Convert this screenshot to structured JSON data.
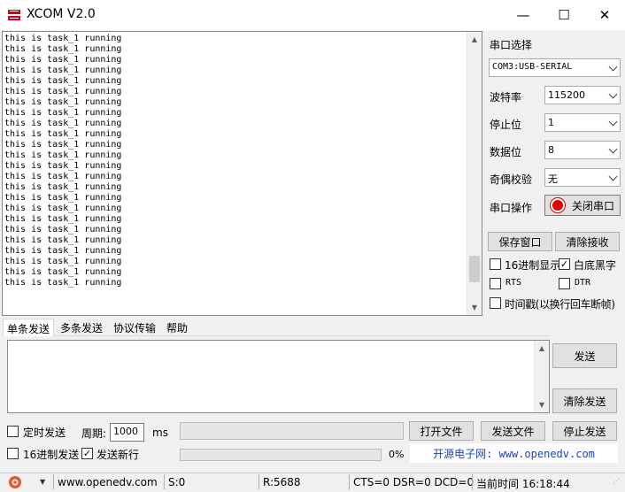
{
  "window": {
    "title": "XCOM V2.0",
    "minimize": "—",
    "maximize": "☐",
    "close": "✕"
  },
  "receive": {
    "lines": [
      "this is task_1 running",
      "this is task_1 running",
      "this is task_1 running",
      "this is task_1 running",
      "this is task_1 running",
      "this is task_1 running",
      "this is task_1 running",
      "this is task_1 running",
      "this is task_1 running",
      "this is task_1 running",
      "this is task_1 running",
      "this is task_1 running",
      "this is task_1 running",
      "this is task_1 running",
      "this is task_1 running",
      "this is task_1 running",
      "this is task_1 running",
      "this is task_1 running",
      "this is task_1 running",
      "this is task_1 running",
      "this is task_1 running",
      "this is task_1 running",
      "this is task_1 running",
      "this is task_1 running"
    ],
    "scroll_position": 0.92
  },
  "serial": {
    "port_label": "串口选择",
    "port_value": "COM3:USB-SERIAL",
    "baud_label": "波特率",
    "baud_value": "115200",
    "stop_label": "停止位",
    "stop_value": "1",
    "data_label": "数据位",
    "data_value": "8",
    "parity_label": "奇偶校验",
    "parity_value": "无",
    "op_label": "串口操作",
    "op_button": "关闭串口",
    "save_button": "保存窗口",
    "clear_recv_button": "清除接收",
    "hex_display": {
      "label": "16进制显示",
      "checked": false
    },
    "white_bg": {
      "label": "白底黑字",
      "checked": true
    },
    "rts": {
      "label": "RTS",
      "checked": false
    },
    "dtr": {
      "label": "DTR",
      "checked": false
    },
    "timestamp": {
      "label": "时间戳(以换行回车断帧)",
      "checked": false
    }
  },
  "tabs": [
    {
      "label": "单条发送",
      "active": true
    },
    {
      "label": "多条发送",
      "active": false
    },
    {
      "label": "协议传输",
      "active": false
    },
    {
      "label": "帮助",
      "active": false
    }
  ],
  "send": {
    "text": "",
    "send_button": "发送",
    "clear_send_button": "清除发送",
    "timed_send": {
      "label": "定时发送",
      "checked": false
    },
    "period_label": "周期:",
    "period_value": "1000",
    "period_unit": "ms",
    "open_file_button": "打开文件",
    "send_file_button": "发送文件",
    "stop_send_button": "停止发送",
    "hex_send": {
      "label": "16进制发送",
      "checked": false
    },
    "newline": {
      "label": "发送新行",
      "checked": true
    },
    "progress_label": "0%",
    "progress": 0,
    "footer_link": "开源电子网: www.openedv.com"
  },
  "status": {
    "url": "www.openedv.com",
    "sent": "S:0",
    "received": "R:5688",
    "lines": "CTS=0 DSR=0 DCD=0",
    "time": "当前时间 16:18:44"
  },
  "colors": {
    "accent": "#e60000",
    "link": "#1a3fbf"
  }
}
